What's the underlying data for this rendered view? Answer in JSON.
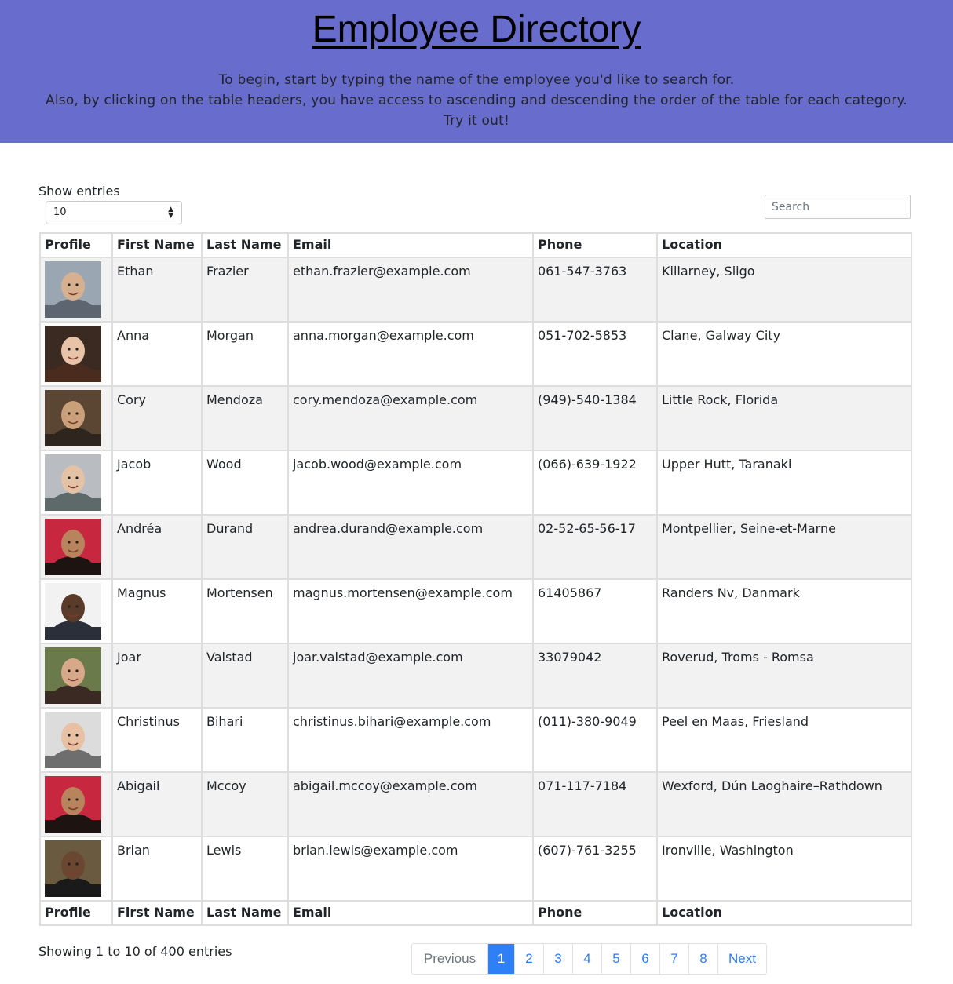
{
  "header": {
    "title": "Employee Directory",
    "line1": "To begin, start by typing the name of the employee you'd like to search for.",
    "line2": "Also, by clicking on the table headers, you have access to ascending and descending the order of the table for each category.",
    "line3": "Try it out!",
    "bg_color": "#686ccc"
  },
  "controls": {
    "show_entries_label": "Show entries",
    "entries_value": "10",
    "search_placeholder": "Search"
  },
  "columns": [
    "Profile",
    "First Name",
    "Last Name",
    "Email",
    "Phone",
    "Location"
  ],
  "rows": [
    {
      "first": "Ethan",
      "last": "Frazier",
      "email": "ethan.frazier@example.com",
      "phone": "061-547-3763",
      "location": "Killarney, Sligo"
    },
    {
      "first": "Anna",
      "last": "Morgan",
      "email": "anna.morgan@example.com",
      "phone": "051-702-5853",
      "location": "Clane, Galway City"
    },
    {
      "first": "Cory",
      "last": "Mendoza",
      "email": "cory.mendoza@example.com",
      "phone": "(949)-540-1384",
      "location": "Little Rock, Florida"
    },
    {
      "first": "Jacob",
      "last": "Wood",
      "email": "jacob.wood@example.com",
      "phone": "(066)-639-1922",
      "location": "Upper Hutt, Taranaki"
    },
    {
      "first": "Andréa",
      "last": "Durand",
      "email": "andrea.durand@example.com",
      "phone": "02-52-65-56-17",
      "location": "Montpellier, Seine-et-Marne"
    },
    {
      "first": "Magnus",
      "last": "Mortensen",
      "email": "magnus.mortensen@example.com",
      "phone": "61405867",
      "location": "Randers Nv, Danmark"
    },
    {
      "first": "Joar",
      "last": "Valstad",
      "email": "joar.valstad@example.com",
      "phone": "33079042",
      "location": "Roverud, Troms - Romsa"
    },
    {
      "first": "Christinus",
      "last": "Bihari",
      "email": "christinus.bihari@example.com",
      "phone": "(011)-380-9049",
      "location": "Peel en Maas, Friesland"
    },
    {
      "first": "Abigail",
      "last": "Mccoy",
      "email": "abigail.mccoy@example.com",
      "phone": "071-117-7184",
      "location": "Wexford, Dún Laoghaire–Rathdown"
    },
    {
      "first": "Brian",
      "last": "Lewis",
      "email": "brian.lewis@example.com",
      "phone": "(607)-761-3255",
      "location": "Ironville, Washington"
    }
  ],
  "footer": {
    "info": "Showing 1 to 10 of 400 entries",
    "previous": "Previous",
    "next": "Next",
    "pages": [
      "1",
      "2",
      "3",
      "4",
      "5",
      "6",
      "7",
      "8"
    ],
    "active_page": "1"
  }
}
